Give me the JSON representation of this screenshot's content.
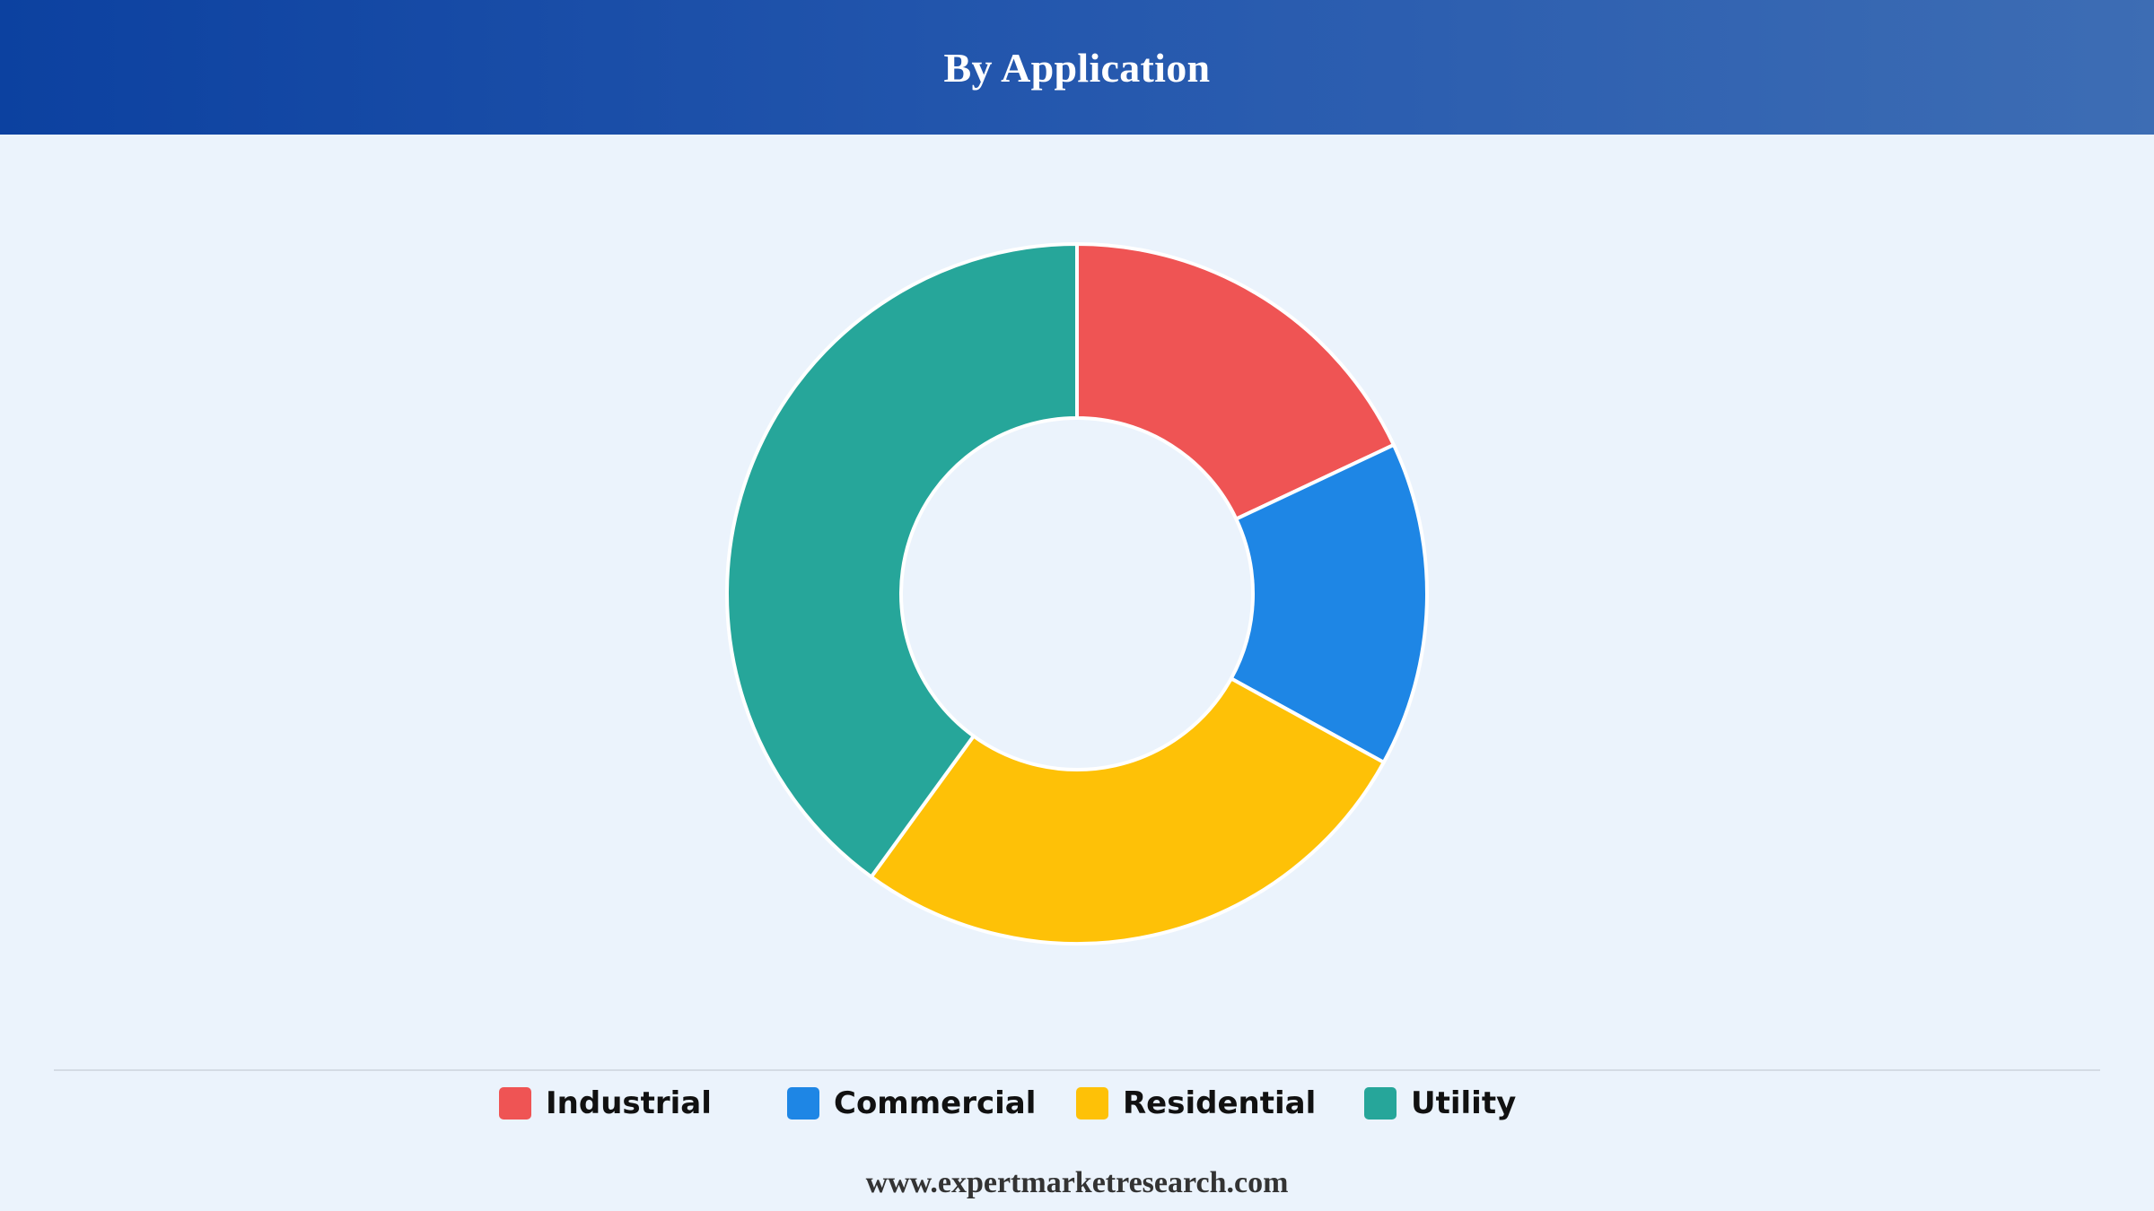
{
  "header": {
    "title": "By Application"
  },
  "chart_data": {
    "type": "pie",
    "donut": true,
    "title": "By Application",
    "categories": [
      "Industrial",
      "Commercial",
      "Residential",
      "Utility"
    ],
    "values": [
      18,
      15,
      27,
      40
    ],
    "colors": [
      "#ef5454",
      "#1e86e5",
      "#fec107",
      "#26a69a"
    ],
    "legend_position": "bottom"
  },
  "legend": {
    "items": [
      {
        "label": "Industrial",
        "color": "#ef5454"
      },
      {
        "label": "Commercial",
        "color": "#1e86e5"
      },
      {
        "label": "Residential",
        "color": "#fec107"
      },
      {
        "label": "Utility",
        "color": "#26a69a"
      }
    ]
  },
  "footer": {
    "website": "www.expertmarketresearch.com"
  }
}
